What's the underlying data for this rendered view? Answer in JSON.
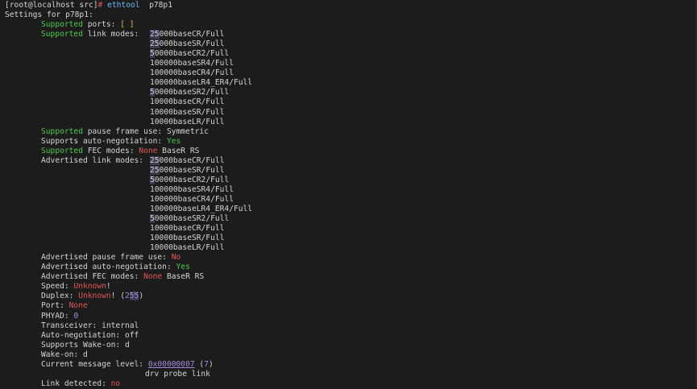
{
  "prompt": {
    "user_host": "[root@localhost src]",
    "symbol": "#",
    "command": " ethtool",
    "argument": "p78p1"
  },
  "header": "Settings for p78p1:",
  "supported_ports": {
    "label1": "Supported",
    "label2": " ports: ",
    "value": "[ ]"
  },
  "supported_link_modes_label": {
    "label1": "Supported",
    "label2": " link modes:"
  },
  "supported_link_modes": [
    {
      "a": "25",
      "b": "000baseCR/Full"
    },
    {
      "a": "25",
      "b": "000baseSR/Full"
    },
    {
      "a": "5",
      "b": "0000baseCR2/Full"
    },
    {
      "a": "",
      "b": "100000baseSR4/Full"
    },
    {
      "a": "",
      "b": "100000baseCR4/Full"
    },
    {
      "a": "",
      "b": "100000baseLR4_ER4/Full"
    },
    {
      "a": "5",
      "b": "0000baseSR2/Full"
    },
    {
      "a": "",
      "b": "10000baseCR/Full"
    },
    {
      "a": "",
      "b": "10000baseSR/Full"
    },
    {
      "a": "",
      "b": "10000baseLR/Full"
    }
  ],
  "supported_pause": {
    "label1": "Supported",
    "label2": " pause frame use: ",
    "value": "Symmetric"
  },
  "supports_autoneg": {
    "label": "Supports auto-negotiation: ",
    "value": "Yes"
  },
  "supported_fec": {
    "label1": "Supported",
    "label2": " FEC modes: ",
    "none": "None",
    "value": " BaseR RS"
  },
  "advertised_link_modes_label": "Advertised link modes:",
  "advertised_link_modes": [
    {
      "a": "25",
      "b": "000baseCR/Full"
    },
    {
      "a": "25",
      "b": "000baseSR/Full"
    },
    {
      "a": "5",
      "b": "0000baseCR2/Full"
    },
    {
      "a": "",
      "b": "100000baseSR4/Full"
    },
    {
      "a": "",
      "b": "100000baseCR4/Full"
    },
    {
      "a": "",
      "b": "100000baseLR4_ER4/Full"
    },
    {
      "a": "5",
      "b": "0000baseSR2/Full"
    },
    {
      "a": "",
      "b": "10000baseCR/Full"
    },
    {
      "a": "",
      "b": "10000baseSR/Full"
    },
    {
      "a": "",
      "b": "10000baseLR/Full"
    }
  ],
  "advertised_pause": {
    "label": "Advertised pause frame use: ",
    "value": "No"
  },
  "advertised_autoneg": {
    "label": "Advertised auto-negotiation: ",
    "value": "Yes"
  },
  "advertised_fec": {
    "label": "Advertised FEC modes: ",
    "none": "None",
    "value": " BaseR RS"
  },
  "speed": {
    "label": "Speed: ",
    "value": "Unknown",
    "suffix": "!"
  },
  "duplex": {
    "label": "Duplex: ",
    "value": "Unknown",
    "mid": "! (",
    "num_a": "2",
    "num_b": "55",
    "suffix": ")"
  },
  "port": {
    "label": "Port: ",
    "value": "None"
  },
  "phyad": {
    "label": "PHYAD: ",
    "value": "0"
  },
  "transceiver": {
    "label": "Transceiver: internal"
  },
  "autoneg": {
    "label": "Auto-negotiation: off"
  },
  "supports_wake": {
    "label": "Supports Wake-on: d"
  },
  "wake_on": {
    "label": "Wake-on: d"
  },
  "msg_level": {
    "label": "Current message level: ",
    "hex": "0x00000007",
    "mid": " (",
    "num": "7",
    "suffix": ")"
  },
  "msg_flags": "drv probe link",
  "link_detected": {
    "label": "Link detected: ",
    "value": "no"
  },
  "colors": {
    "background": "#1c1c1c",
    "text": "#d4d4d4",
    "green": "#4fc84f",
    "red": "#e05555",
    "purple": "#a88bdc",
    "blue": "#6cb6ff"
  }
}
